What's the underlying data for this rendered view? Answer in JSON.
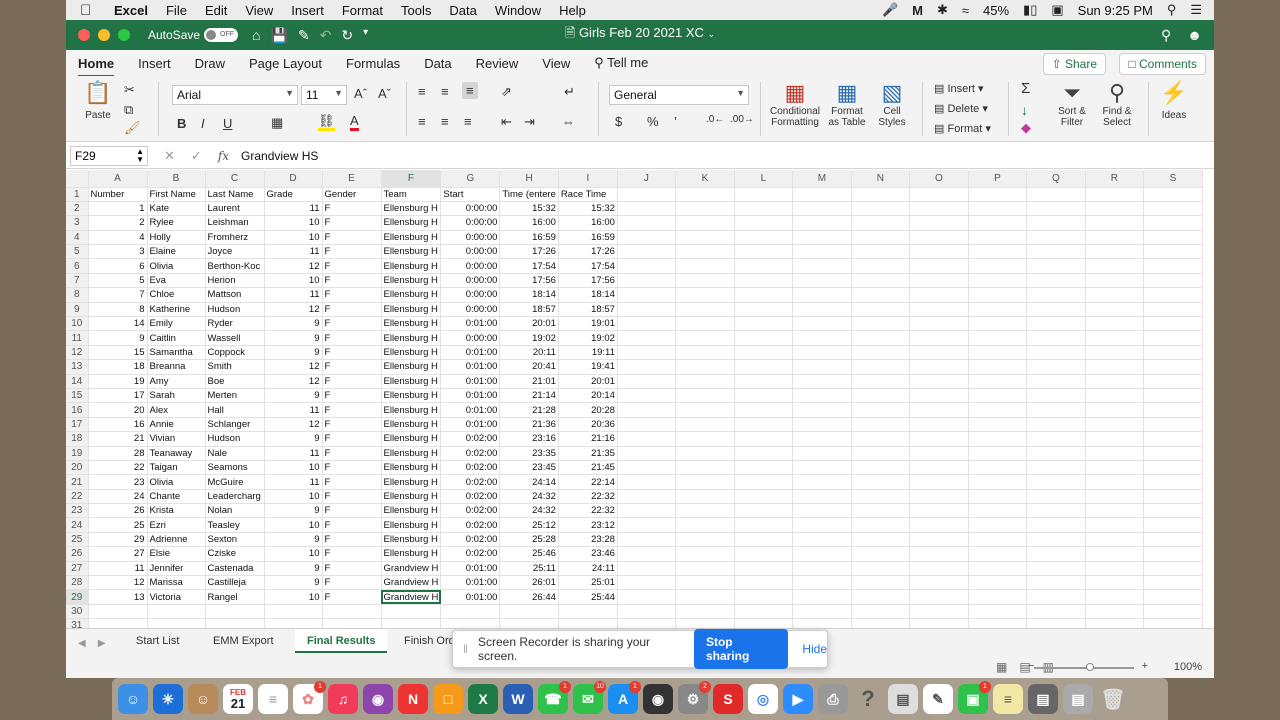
{
  "menubar": {
    "app": "Excel",
    "items": [
      "File",
      "Edit",
      "View",
      "Insert",
      "Format",
      "Tools",
      "Data",
      "Window",
      "Help"
    ],
    "battery": "45%",
    "clock": "Sun 9:25 PM"
  },
  "titlebar": {
    "autosave_label": "AutoSave",
    "autosave_state": "OFF",
    "document": "Girls Feb 20 2021 XC"
  },
  "ribbon_tabs": [
    "Home",
    "Insert",
    "Draw",
    "Page Layout",
    "Formulas",
    "Data",
    "Review",
    "View",
    "Tell me"
  ],
  "share_label": "Share",
  "comments_label": "Comments",
  "ribbon": {
    "paste": "Paste",
    "font_name": "Arial",
    "font_size": "11",
    "number_format": "General",
    "conditional_formatting": [
      "Conditional",
      "Formatting"
    ],
    "format_as_table": [
      "Format",
      "as Table"
    ],
    "cell_styles": [
      "Cell",
      "Styles"
    ],
    "insert": "Insert",
    "delete": "Delete",
    "format": "Format",
    "sort_filter": [
      "Sort &",
      "Filter"
    ],
    "find_select": [
      "Find &",
      "Select"
    ],
    "ideas": "Ideas"
  },
  "formula_bar": {
    "name_box": "F29",
    "fx": "fx",
    "value": "Grandview HS"
  },
  "sheet": {
    "columns": [
      "A",
      "B",
      "C",
      "D",
      "E",
      "F",
      "G",
      "H",
      "I",
      "J",
      "K",
      "L",
      "M",
      "N",
      "O",
      "P",
      "Q",
      "R",
      "S"
    ],
    "rows": [
      [
        "Number",
        "First Name",
        "Last Name",
        "Grade",
        "Gender",
        "Team",
        "Start",
        "Time (entere",
        "Race Time"
      ],
      [
        "1",
        "Kate",
        "Laurent",
        "11",
        "F",
        "Ellensburg H",
        "0:00:00",
        "15:32",
        "15:32"
      ],
      [
        "2",
        "Rylee",
        "Leishman",
        "10",
        "F",
        "Ellensburg H",
        "0:00:00",
        "16:00",
        "16:00"
      ],
      [
        "4",
        "Holly",
        "Fromherz",
        "10",
        "F",
        "Ellensburg H",
        "0:00:00",
        "16:59",
        "16:59"
      ],
      [
        "3",
        "Elaine",
        "Joyce",
        "11",
        "F",
        "Ellensburg H",
        "0:00:00",
        "17:26",
        "17:26"
      ],
      [
        "6",
        "Olivia",
        "Berthon-Koc",
        "12",
        "F",
        "Ellensburg H",
        "0:00:00",
        "17:54",
        "17:54"
      ],
      [
        "5",
        "Eva",
        "Herion",
        "10",
        "F",
        "Ellensburg H",
        "0:00:00",
        "17:56",
        "17:56"
      ],
      [
        "7",
        "Chloe",
        "Mattson",
        "11",
        "F",
        "Ellensburg H",
        "0:00:00",
        "18:14",
        "18:14"
      ],
      [
        "8",
        "Katherine",
        "Hudson",
        "12",
        "F",
        "Ellensburg H",
        "0:00:00",
        "18:57",
        "18:57"
      ],
      [
        "14",
        "Emily",
        "Ryder",
        "9",
        "F",
        "Ellensburg H",
        "0:01:00",
        "20:01",
        "19:01"
      ],
      [
        "9",
        "Caitlin",
        "Wassell",
        "9",
        "F",
        "Ellensburg H",
        "0:00:00",
        "19:02",
        "19:02"
      ],
      [
        "15",
        "Samantha",
        "Coppock",
        "9",
        "F",
        "Ellensburg H",
        "0:01:00",
        "20:11",
        "19:11"
      ],
      [
        "18",
        "Breanna",
        "Smith",
        "12",
        "F",
        "Ellensburg H",
        "0:01:00",
        "20:41",
        "19:41"
      ],
      [
        "19",
        "Amy",
        "Boe",
        "12",
        "F",
        "Ellensburg H",
        "0:01:00",
        "21:01",
        "20:01"
      ],
      [
        "17",
        "Sarah",
        "Merten",
        "9",
        "F",
        "Ellensburg H",
        "0:01:00",
        "21:14",
        "20:14"
      ],
      [
        "20",
        "Alex",
        "Hall",
        "11",
        "F",
        "Ellensburg H",
        "0:01:00",
        "21:28",
        "20:28"
      ],
      [
        "16",
        "Annie",
        "Schlanger",
        "12",
        "F",
        "Ellensburg H",
        "0:01:00",
        "21:36",
        "20:36"
      ],
      [
        "21",
        "Vivian",
        "Hudson",
        "9",
        "F",
        "Ellensburg H",
        "0:02:00",
        "23:16",
        "21:16"
      ],
      [
        "28",
        "Teanaway",
        "Nale",
        "11",
        "F",
        "Ellensburg H",
        "0:02:00",
        "23:35",
        "21:35"
      ],
      [
        "22",
        "Taigan",
        "Seamons",
        "10",
        "F",
        "Ellensburg H",
        "0:02:00",
        "23:45",
        "21:45"
      ],
      [
        "23",
        "Olivia",
        "McGuire",
        "11",
        "F",
        "Ellensburg H",
        "0:02:00",
        "24:14",
        "22:14"
      ],
      [
        "24",
        "Chante",
        "Leadercharg",
        "10",
        "F",
        "Ellensburg H",
        "0:02:00",
        "24:32",
        "22:32"
      ],
      [
        "26",
        "Krista",
        "Nolan",
        "9",
        "F",
        "Ellensburg H",
        "0:02:00",
        "24:32",
        "22:32"
      ],
      [
        "25",
        "Ezri",
        "Teasley",
        "10",
        "F",
        "Ellensburg H",
        "0:02:00",
        "25:12",
        "23:12"
      ],
      [
        "29",
        "Adrienne",
        "Sexton",
        "9",
        "F",
        "Ellensburg H",
        "0:02:00",
        "25:28",
        "23:28"
      ],
      [
        "27",
        "Elsie",
        "Cziske",
        "10",
        "F",
        "Ellensburg H",
        "0:02:00",
        "25:46",
        "23:46"
      ],
      [
        "11",
        "Jennifer",
        "Castenada",
        "9",
        "F",
        "Grandview H",
        "0:01:00",
        "25:11",
        "24:11"
      ],
      [
        "12",
        "Marissa",
        "Castilleja",
        "9",
        "F",
        "Grandview H",
        "0:01:00",
        "26:01",
        "25:01"
      ],
      [
        "13",
        "Victoria",
        "Rangel",
        "10",
        "F",
        "Grandview H",
        "0:01:00",
        "26:44",
        "25:44"
      ],
      [
        "",
        "",
        "",
        "",
        "",
        "",
        "",
        "",
        ""
      ],
      [
        "",
        "",
        "",
        "",
        "",
        "",
        "",
        "",
        ""
      ]
    ]
  },
  "sheet_tabs": [
    "Start List",
    "EMM Export",
    "Final Results",
    "Finish Ord"
  ],
  "active_sheet": "Final Results",
  "zoom": "100%",
  "recorder": {
    "message": "Screen Recorder is sharing your screen.",
    "stop": "Stop sharing",
    "hide": "Hide"
  },
  "dock": {
    "calendar_month": "FEB",
    "calendar_day": "21",
    "badges": [
      "1",
      "1",
      "10",
      "1",
      "2",
      "1"
    ]
  },
  "colors": {
    "excel_green": "#217346",
    "accent_blue": "#1a73e8"
  }
}
